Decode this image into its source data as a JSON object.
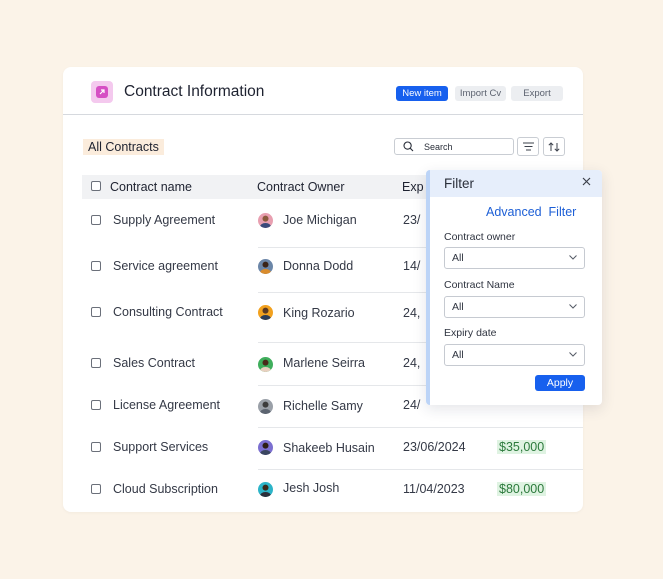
{
  "header": {
    "title": "Contract Information",
    "buttons": {
      "new_item": "New item",
      "import": "Import Cv",
      "export": "Export"
    }
  },
  "toolbar": {
    "view_label": "All Contracts",
    "search_placeholder": "Search"
  },
  "table": {
    "columns": {
      "name": "Contract name",
      "owner": "Contract Owner",
      "expiry": "Exp"
    },
    "rows": [
      {
        "name": "Supply Agreement",
        "owner": "Joe Michigan",
        "date": "23/",
        "amount": ""
      },
      {
        "name": "Service agreement",
        "owner": "Donna Dodd",
        "date": "14/",
        "amount": ""
      },
      {
        "name": "Consulting Contract",
        "owner": "King Rozario",
        "date": "24,",
        "amount": ""
      },
      {
        "name": "Sales Contract",
        "owner": "Marlene Seirra",
        "date": "24,",
        "amount": ""
      },
      {
        "name": "License Agreement",
        "owner": "Richelle Samy",
        "date": "24/",
        "amount": ""
      },
      {
        "name": "Support Services",
        "owner": "Shakeeb Husain",
        "date": "23/06/2024",
        "amount": "$35,000"
      },
      {
        "name": "Cloud Subscription",
        "owner": "Jesh Josh",
        "date": "11/04/2023",
        "amount": "$80,000"
      }
    ]
  },
  "filter": {
    "title": "Filter",
    "advanced_label": "Advanced  Filter",
    "fields": [
      {
        "label": "Contract owner",
        "value": "All"
      },
      {
        "label": "Contract Name",
        "value": "All"
      },
      {
        "label": "Expiry date",
        "value": "All"
      }
    ],
    "apply_label": "Apply"
  },
  "colors": {
    "primary": "#1760ee",
    "background": "#fbf3e8",
    "amount_bg": "#dff3e2",
    "amount_text": "#2c7a3c",
    "app_icon": "#d64fc4"
  }
}
